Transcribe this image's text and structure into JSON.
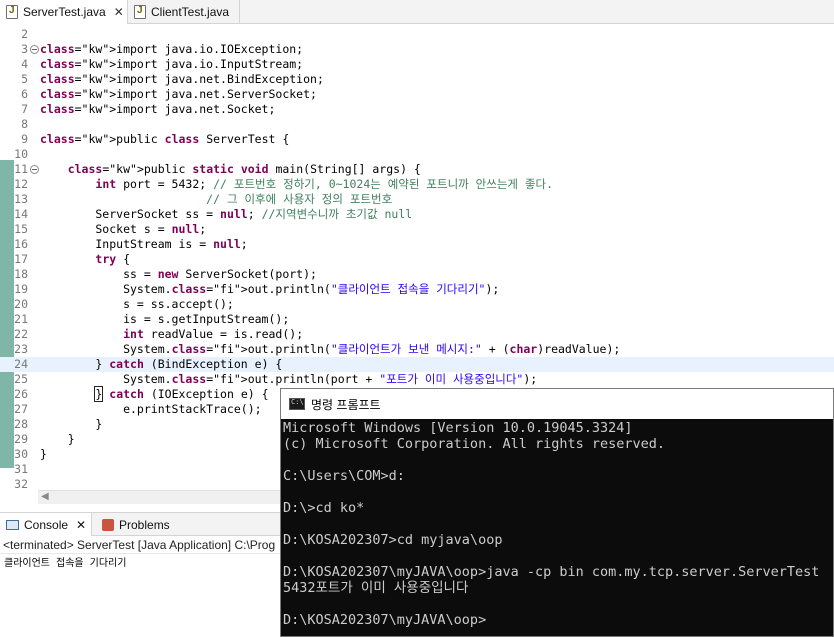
{
  "tabs": [
    {
      "label": "ServerTest.java",
      "close": "✕"
    },
    {
      "label": "ClientTest.java"
    }
  ],
  "code_lines": [
    {
      "n": "2",
      "t": ""
    },
    {
      "n": "3",
      "t": "import java.io.IOException;"
    },
    {
      "n": "4",
      "t": "import java.io.InputStream;"
    },
    {
      "n": "5",
      "t": "import java.net.BindException;"
    },
    {
      "n": "6",
      "t": "import java.net.ServerSocket;"
    },
    {
      "n": "7",
      "t": "import java.net.Socket;"
    },
    {
      "n": "8",
      "t": ""
    },
    {
      "n": "9",
      "t": "public class ServerTest {"
    },
    {
      "n": "10",
      "t": ""
    },
    {
      "n": "11",
      "t": "    public static void main(String[] args) {"
    },
    {
      "n": "12",
      "t": "        int port = 5432; // 포트번호 정하기, 0~1024는 예약된 포트니까 안쓰는게 좋다."
    },
    {
      "n": "13",
      "t": "                        // 그 이후에 사용자 정의 포트번호"
    },
    {
      "n": "14",
      "t": "        ServerSocket ss = null; //지역변수니까 초기값 null"
    },
    {
      "n": "15",
      "t": "        Socket s = null;"
    },
    {
      "n": "16",
      "t": "        InputStream is = null;"
    },
    {
      "n": "17",
      "t": "        try {"
    },
    {
      "n": "18",
      "t": "            ss = new ServerSocket(port);"
    },
    {
      "n": "19",
      "t": "            System.out.println(\"클라이언트 접속을 기다리기\");"
    },
    {
      "n": "20",
      "t": "            s = ss.accept();"
    },
    {
      "n": "21",
      "t": "            is = s.getInputStream();"
    },
    {
      "n": "22",
      "t": "            int readValue = is.read();"
    },
    {
      "n": "23",
      "t": "            System.out.println(\"클라이언트가 보낸 메시지:\" + (char)readValue);"
    },
    {
      "n": "24",
      "t": "        } catch (BindException e) {"
    },
    {
      "n": "25",
      "t": "            System.out.println(port + \"포트가 이미 사용중입니다\");"
    },
    {
      "n": "26",
      "t": "        } catch (IOException e) {"
    },
    {
      "n": "27",
      "t": "            e.printStackTrace();"
    },
    {
      "n": "28",
      "t": "        }"
    },
    {
      "n": "29",
      "t": "    }"
    },
    {
      "n": "30",
      "t": "}"
    },
    {
      "n": "31",
      "t": ""
    },
    {
      "n": "32",
      "t": ""
    }
  ],
  "console_tabs": {
    "console": "Console",
    "console_close": "✕",
    "problems": "Problems"
  },
  "console": {
    "header": "<terminated> ServerTest [Java Application] C:\\Prog",
    "output": "클라이언트 접속을 기다리기"
  },
  "cmd": {
    "title": "명령 프롬프트",
    "lines": [
      "Microsoft Windows [Version 10.0.19045.3324]",
      "(c) Microsoft Corporation. All rights reserved.",
      "",
      "C:\\Users\\COM>d:",
      "",
      "D:\\>cd ko*",
      "",
      "D:\\KOSA202307>cd myjava\\oop",
      "",
      "D:\\KOSA202307\\myJAVA\\oop>java -cp bin com.my.tcp.server.ServerTest",
      "5432포트가 이미 사용중입니다",
      "",
      "D:\\KOSA202307\\myJAVA\\oop>"
    ]
  },
  "colors": {
    "keyword": "#7f0055",
    "string": "#2a00ff",
    "comment": "#3f7f5f",
    "field": "#0000c0"
  }
}
